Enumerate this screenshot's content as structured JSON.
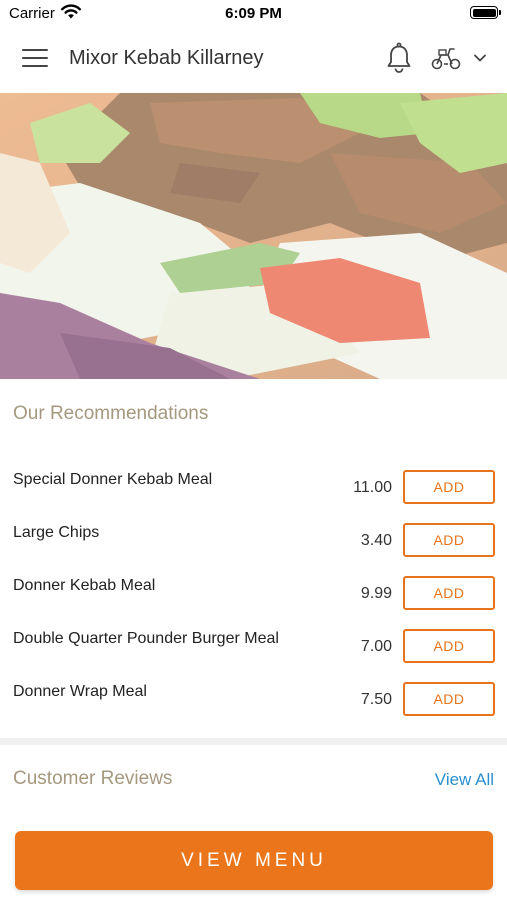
{
  "status_bar": {
    "carrier": "Carrier",
    "time": "6:09 PM"
  },
  "header": {
    "title": "Mixor Kebab Killarney"
  },
  "recommendations": {
    "title": "Our Recommendations",
    "items": [
      {
        "name": "Special Donner Kebab Meal",
        "price": "11.00",
        "button": "ADD"
      },
      {
        "name": "Large Chips",
        "price": "3.40",
        "button": "ADD"
      },
      {
        "name": "Donner Kebab Meal",
        "price": "9.99",
        "button": "ADD"
      },
      {
        "name": "Double Quarter Pounder Burger Meal",
        "price": "7.00",
        "button": "ADD"
      },
      {
        "name": "Donner Wrap Meal",
        "price": "7.50",
        "button": "ADD"
      }
    ]
  },
  "reviews": {
    "title": "Customer Reviews",
    "view_all": "View All"
  },
  "footer": {
    "view_menu": "VIEW MENU"
  },
  "colors": {
    "accent": "#ea751a",
    "section_title": "#a5987e",
    "link": "#2b8fd0"
  },
  "icons": [
    "wifi-icon",
    "battery-icon",
    "menu-icon",
    "bell-icon",
    "scooter-icon",
    "chevron-down-icon"
  ]
}
